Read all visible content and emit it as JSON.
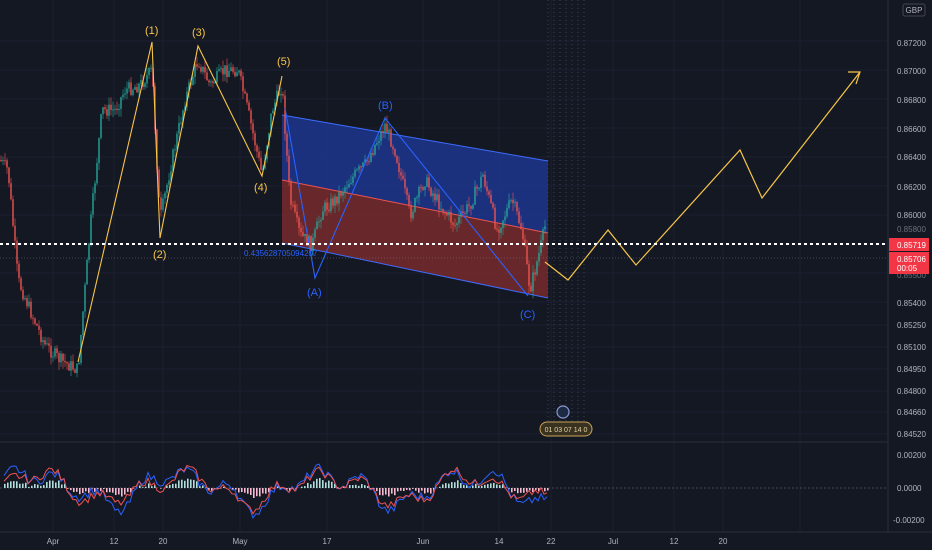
{
  "header": {
    "currency": "GBP"
  },
  "price_axis": {
    "ticks": [
      "0.87200",
      "0.87000",
      "0.86800",
      "0.86600",
      "0.86400",
      "0.86200",
      "0.86000",
      "0.85800",
      "0.85500",
      "0.85400",
      "0.85250",
      "0.85100",
      "0.84950",
      "0.84800",
      "0.84660",
      "0.84520"
    ],
    "last_price": "0.85719",
    "prev_price": "0.85706",
    "countdown": "00:05",
    "last_price_color": "#f23645"
  },
  "oscillator_axis": {
    "ticks": [
      "0.00200",
      "0.0000",
      "-0.00200"
    ]
  },
  "time_axis": {
    "labels": [
      "Apr",
      "12",
      "20",
      "May",
      "17",
      "Jun",
      "14",
      "22",
      "Jul",
      "12",
      "20"
    ]
  },
  "channel": {
    "value_label": "0.435628705094207"
  },
  "event_badge": {
    "text": "01 03 07 14 0"
  },
  "waves": {
    "impulse": [
      "(1)",
      "(2)",
      "(3)",
      "(4)",
      "(5)"
    ],
    "correction": [
      "(A)",
      "(B)",
      "(C)"
    ],
    "impulse_color": "#f7c548",
    "correction_color": "#2962ff"
  },
  "colors": {
    "up_candle": "#26a69a",
    "down_candle": "#ef5350",
    "projection": "#f7c548",
    "price_line": "#ffffff",
    "channel_upper_fill": "#1e3a9e",
    "channel_lower_fill": "#8b2e2e"
  },
  "chart_data": {
    "type": "line",
    "title": "",
    "xlabel": "",
    "ylabel": "",
    "x": [
      "Apr",
      "12",
      "20",
      "May",
      "17",
      "Jun",
      "14",
      "22",
      "Jul",
      "12",
      "20"
    ],
    "ylim": [
      0.8445,
      0.873
    ],
    "series": [
      {
        "values": [
          {
            "x": "Mar-end",
            "y": 0.863
          },
          {
            "x": "Apr",
            "y": 0.8495
          },
          {
            "x": "Apr+2",
            "y": 0.848
          },
          {
            "x": "12",
            "y": 0.8675
          },
          {
            "x": "18",
            "y": 0.8695
          },
          {
            "x": "20",
            "y": 0.859
          },
          {
            "x": "25",
            "y": 0.871
          },
          {
            "x": "May",
            "y": 0.87
          },
          {
            "x": "May+5",
            "y": 0.865
          },
          {
            "x": "May+8",
            "y": 0.8695
          },
          {
            "x": "17",
            "y": 0.858
          },
          {
            "x": "Jun",
            "y": 0.866
          },
          {
            "x": "14",
            "y": 0.86
          },
          {
            "x": "22",
            "y": 0.856
          }
        ]
      }
    ]
  }
}
